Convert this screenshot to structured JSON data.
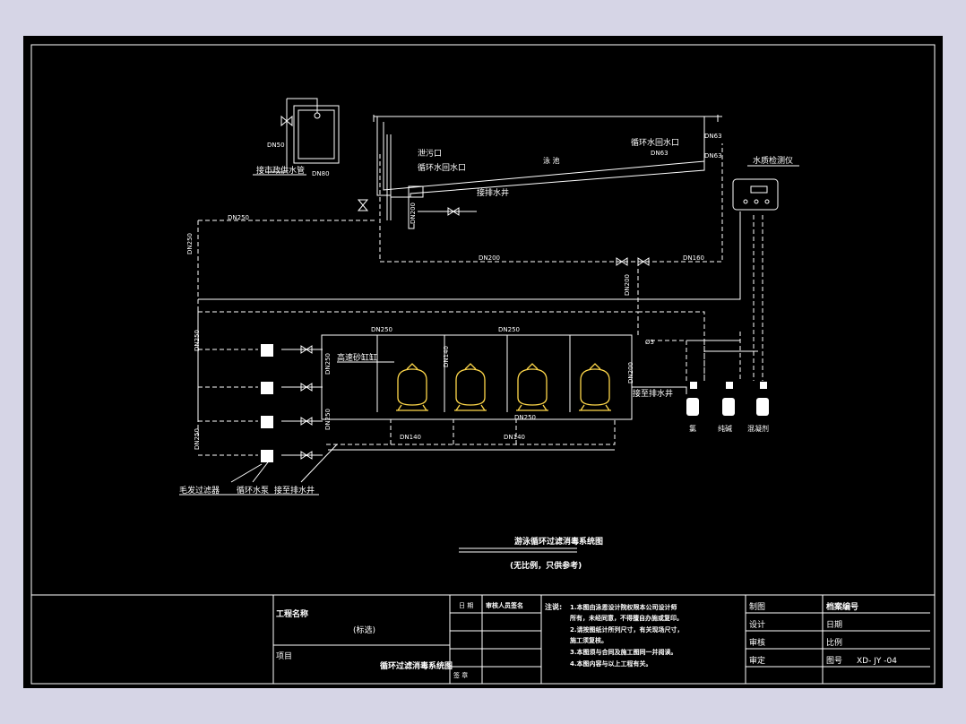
{
  "drawing": {
    "title": "游泳循环过滤消毒系统图",
    "note": "(无比例，只供参考)",
    "pool_label": "泳  池",
    "instrument": "水质检测仪",
    "labels": {
      "city_water": "接市政供水管",
      "drain_outlet": "泄污口",
      "return_inlet_left": "循环水回水口",
      "return_inlet_right": "循环水回水口",
      "to_drain_pit": "接排水井",
      "sand_tank": "高速砂缸缸",
      "to_drain_pit_2": "接至排水井",
      "hair_filter": "毛发过滤器",
      "pump": "循环水泵",
      "to_drain_pit_3": "接至排水井",
      "chem_1": "氯",
      "chem_2": "纯碱",
      "chem_3": "混凝剂"
    },
    "pipes": {
      "dn50": "DN50",
      "dn80": "DN80",
      "dn63_a": "DN63",
      "dn63_b": "DN63",
      "dn63_c": "DN63",
      "dn250_top": "DN250",
      "dn250_left": "DN250",
      "dn200_a": "DN200",
      "dn200_b": "DN200",
      "dn160": "DN160",
      "dn200_v": "DN200",
      "dn250_l2": "DN250",
      "dn250_h1": "DN250",
      "dn250_h2": "DN250",
      "dn250_v3": "DN250",
      "dn250_v4": "DN250",
      "dn250_v5": "DN250",
      "dn200_v6": "DN200",
      "dn140": "DN140",
      "dn250_bot": "DN250",
      "dn140_b1": "DN140",
      "dn140_b2": "DN140",
      "phi3": "Ø3"
    }
  },
  "title_block": {
    "project_name_label": "工程名称",
    "project_name_value": "(标选)",
    "item_label": "项目",
    "item_value": "循环过滤消毒系统图",
    "date_label": "日 期",
    "reviewer_label": "审核人员签名",
    "seal_label": "签 章",
    "notes_label": "注说:",
    "notes": [
      "1.本图由泳恩设计院权限本公司设计师",
      "  所有，未经同意，不得擅自办施或复印。",
      "2.请按图纸计所列尺寸，有关现场尺寸，",
      "  施工须复核。",
      "3.本图须与合同及施工图同一并阅读。",
      "4.本图内容与以上工程有关。"
    ],
    "drawn_label": "制图",
    "archive_label": "档案编号",
    "design_label": "设计",
    "date2_label": "日期",
    "check_label": "审核",
    "scale_label": "比例",
    "approve_label": "审定",
    "drawing_no_label": "图号",
    "drawing_no_value": "XD- JY -04"
  }
}
